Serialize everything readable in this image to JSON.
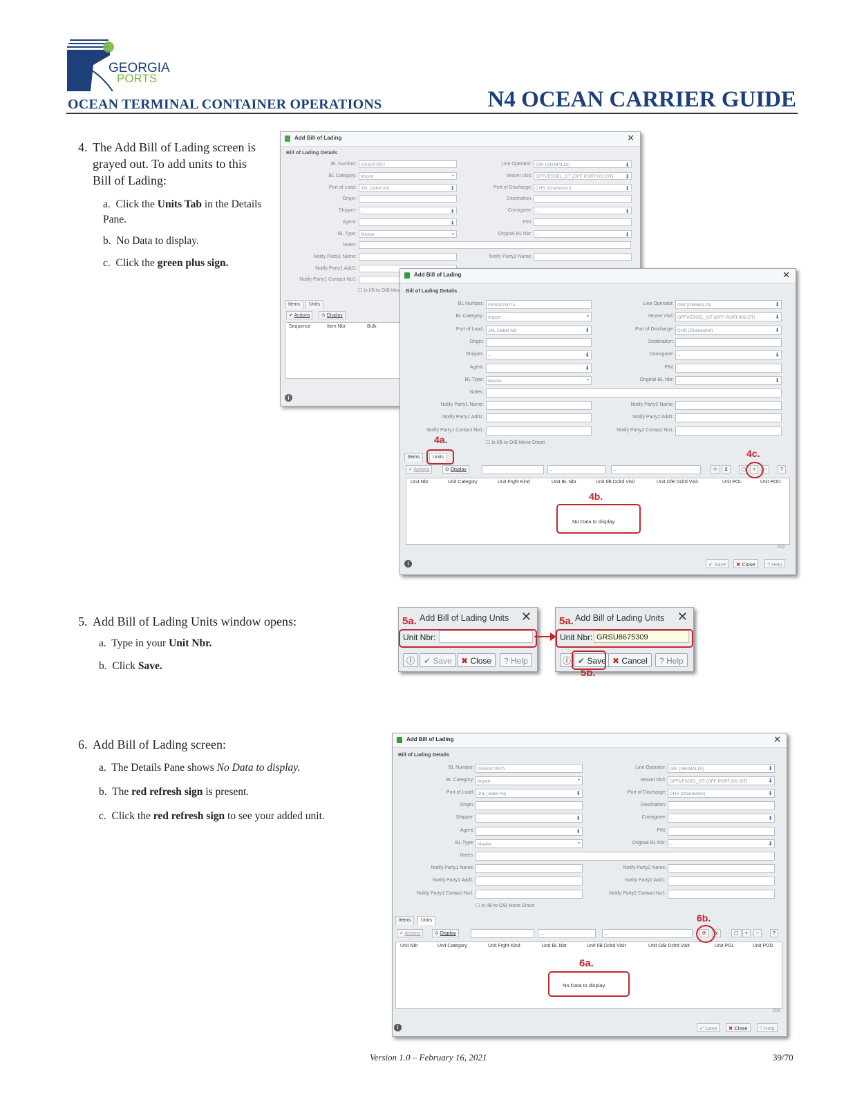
{
  "header": {
    "logo_line1": "GEORGIA",
    "logo_line2": "PORTS",
    "left_title": "OCEAN TERMINAL CONTAINER OPERATIONS",
    "right_title": "N4 OCEAN CARRIER GUIDE"
  },
  "colors": {
    "navy": "#1d3f7a",
    "accent_green": "#7ab648",
    "annotation_red": "#c0272d"
  },
  "step4": {
    "num": "4.",
    "text": "The Add Bill of Lading screen is grayed out.  To add units to this Bill of Lading:",
    "a_pre": "Click the ",
    "a_bold": "Units Tab",
    "a_post": " in the Details Pane.",
    "b": "No Data to display.",
    "c_pre": "Click the ",
    "c_bold": "green plus sign."
  },
  "step5": {
    "num": "5.",
    "text": "Add Bill of Lading Units window opens:",
    "a_pre": "Type in your ",
    "a_bold": "Unit Nbr.",
    "b_pre": "Click ",
    "b_bold": "Save."
  },
  "step6": {
    "num": "6.",
    "text": "Add Bill of Lading screen:",
    "a_pre": "The Details Pane shows ",
    "a_ital": "No Data to display.",
    "b_pre": "The ",
    "b_bold": "red refresh sign",
    "b_post": " is present.",
    "c_pre": "Click the ",
    "c_bold": "red refresh sign",
    "c_post": " to see your added unit."
  },
  "bol": {
    "title": "Add Bill of Lading",
    "section": "Bill of Lading Details",
    "labels": {
      "bl_number": "BL Number:",
      "bl_category": "BL Category:",
      "port_of_load": "Port of Load:",
      "origin": "Origin:",
      "shipper": "Shipper:",
      "agent": "Agent:",
      "bl_type": "BL Type:",
      "notes": "Notes:",
      "np1_name": "Notify Party1 Name:",
      "np1_add1": "Notify Party1 Add1:",
      "np1_contact": "Notify Party1 Contact No1:",
      "line_operator": "Line Operator:",
      "vessel_visit": "Vessel Visit:",
      "port_of_discharge": "Port of Discharge:",
      "destination": "Destination:",
      "consignee": "Consignee:",
      "pin": "PIN:",
      "orig_bl_nbr": "Original BL Nbr:",
      "np2_name": "Notify Party2 Name:",
      "np2_add1": "Notify Party2 Add1:",
      "np2_contact": "Notify Party2 Contact No1:"
    },
    "values": {
      "bl_number_a": "GSS007007",
      "bl_number_b": "GSS007007A",
      "bl_category": "Import",
      "port_of_load": "JAL (Jebel Ali)",
      "dash": "--",
      "bl_type": "Master",
      "line_operator": "GRI (GRIMALDI)",
      "vessel_visit": "OFFVESSEL_OT (OFF PORT,002,OT)",
      "port_of_discharge": "CHS (Charleston)"
    },
    "move_direct": "Is I/B to O/B Move Direct",
    "tab_items": "Items",
    "tab_units": "Units",
    "actions": "Actions",
    "display": "Display",
    "items_cols": [
      "Sequence",
      "Item Nbr",
      "Bulk"
    ],
    "units_cols": [
      "Unit Nbr",
      "Unit Category",
      "Unit Frght Kind",
      "Unit BL Nbr",
      "Unit I/B Dclrd Visit",
      "Unit O/B Dclrd Visit",
      "Unit POL",
      "Unit POD"
    ],
    "no_data": "No Data to display.",
    "count": "0:0",
    "save": "Save",
    "close": "Close",
    "help": "Help"
  },
  "units_dialog": {
    "title": "Add Bill of Lading Units",
    "label": "Unit Nbr:",
    "value": "GRSU8675309",
    "save": "Save",
    "close": "Close",
    "cancel": "Cancel",
    "help": "Help"
  },
  "annotations": {
    "a4a": "4a.",
    "a4b": "4b.",
    "a4c": "4c.",
    "a5a": "5a.",
    "a5b": "5b.",
    "a6a": "6a.",
    "a6b": "6b."
  },
  "footer": {
    "version": "Version 1.0 – February 16, 2021",
    "page": "39/70"
  }
}
